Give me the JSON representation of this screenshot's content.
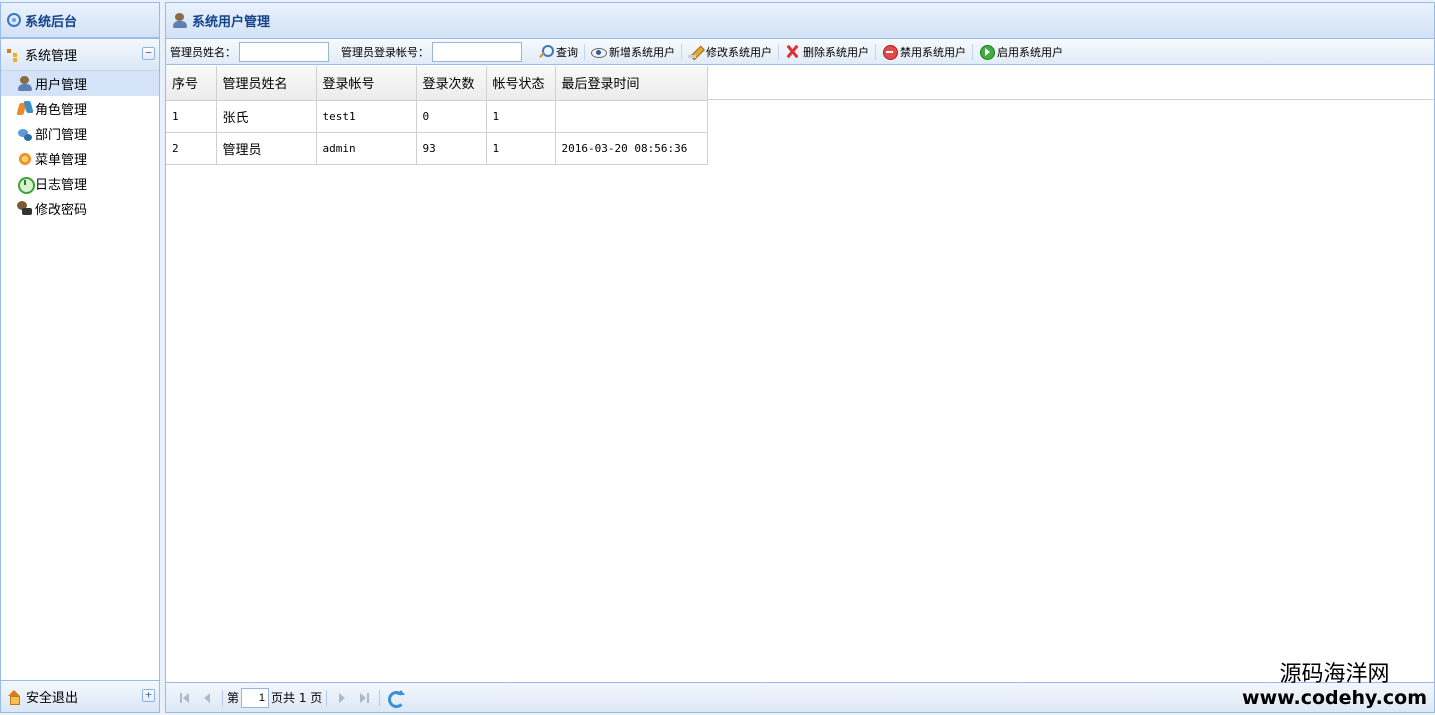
{
  "sidebar": {
    "title": "系统后台",
    "section": {
      "label": "系统管理",
      "toggle": "−"
    },
    "items": [
      {
        "label": "用户管理",
        "icon": "user-icon"
      },
      {
        "label": "角色管理",
        "icon": "role-icon"
      },
      {
        "label": "部门管理",
        "icon": "department-icon"
      },
      {
        "label": "菜单管理",
        "icon": "menu-icon"
      },
      {
        "label": "日志管理",
        "icon": "log-icon"
      },
      {
        "label": "修改密码",
        "icon": "password-icon"
      }
    ],
    "footer": {
      "label": "安全退出",
      "toggle": "+"
    }
  },
  "main": {
    "title": "系统用户管理",
    "toolbar": {
      "name_label": "管理员姓名：",
      "name_value": "",
      "account_label": "管理员登录帐号：",
      "account_value": "",
      "buttons": {
        "search": "查询",
        "add": "新增系统用户",
        "edit": "修改系统用户",
        "delete": "删除系统用户",
        "disable": "禁用系统用户",
        "enable": "启用系统用户"
      }
    },
    "table": {
      "columns": [
        "序号",
        "管理员姓名",
        "登录帐号",
        "登录次数",
        "帐号状态",
        "最后登录时间"
      ],
      "rows": [
        [
          "1",
          "张氏",
          "test1",
          "0",
          "1",
          ""
        ],
        [
          "2",
          "管理员",
          "admin",
          "93",
          "1",
          "2016-03-20 08:56:36"
        ]
      ]
    },
    "pager": {
      "prefix": "第",
      "page": "1",
      "suffix": "页共 1 页"
    }
  },
  "watermark": {
    "cn": "源码海洋网",
    "url": "www.codehy.com"
  }
}
